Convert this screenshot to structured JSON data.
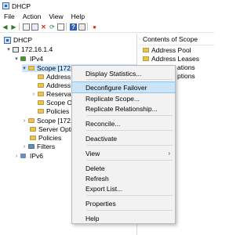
{
  "window": {
    "title": "DHCP"
  },
  "menubar": [
    "File",
    "Action",
    "View",
    "Help"
  ],
  "tree": {
    "root": "DHCP",
    "server": "172.16.1.4",
    "ipv4": "IPv4",
    "scope": "Scope [172.16.0.0] Lab Scope",
    "children": [
      "Address Pool",
      "Address Leases",
      "Reservations",
      "Scope Options",
      "Policies"
    ],
    "scope2": "Scope [172.",
    "server_options": "Server Opti",
    "policies": "Policies",
    "filters": "Filters",
    "ipv6": "IPv6"
  },
  "right_pane": {
    "header": "Contents of Scope",
    "items": [
      "Address Pool",
      "Address Leases",
      "ations",
      "ptions"
    ]
  },
  "context_menu": {
    "items": [
      "Display Statistics...",
      "Deconfigure Failover",
      "Replicate Scope...",
      "Replicate Relationship...",
      "Reconcile...",
      "Deactivate",
      "View",
      "Delete",
      "Refresh",
      "Export List...",
      "Properties",
      "Help"
    ],
    "highlighted": "Deconfigure Failover"
  }
}
